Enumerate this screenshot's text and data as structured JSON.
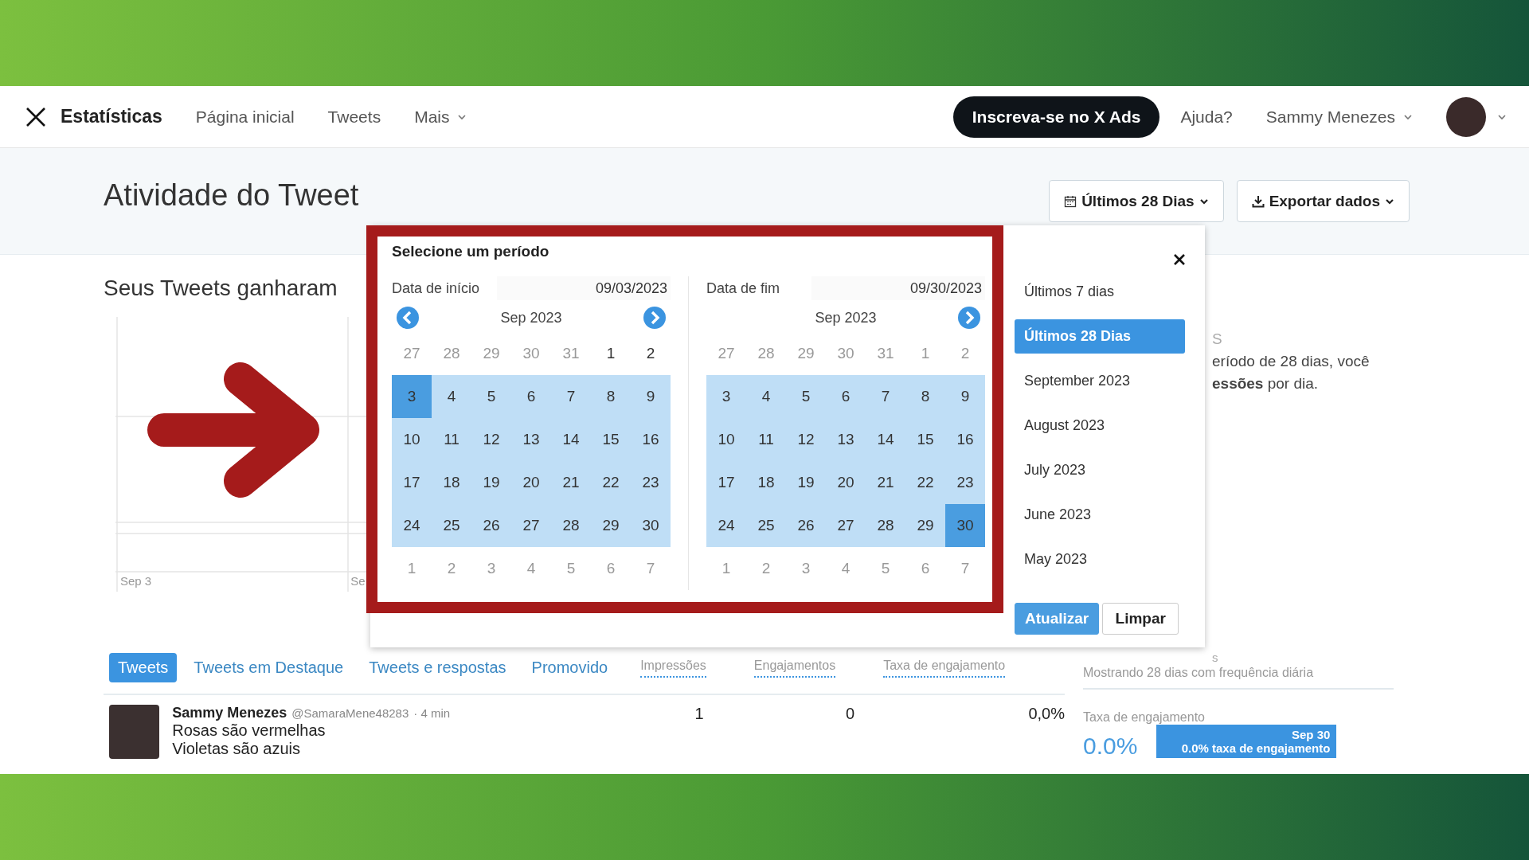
{
  "nav": {
    "brand": "Estatísticas",
    "links": [
      {
        "label": "Página inicial",
        "dropdown": false
      },
      {
        "label": "Tweets",
        "dropdown": false
      },
      {
        "label": "Mais",
        "dropdown": true
      }
    ],
    "ads_button": "Inscreva-se no X Ads",
    "help": "Ajuda?",
    "user": "Sammy Menezes"
  },
  "header": {
    "title": "Atividade do Tweet",
    "range_button": "Últimos 28 Dias",
    "export_button": "Exportar dados"
  },
  "summary": {
    "heading": "Seus Tweets ganharam",
    "side_heading": "S",
    "side_lines": [
      "eríodo de 28 dias, você",
      "**essões** por dia."
    ]
  },
  "chart": {
    "x_labels": [
      "Sep 3",
      "Se"
    ]
  },
  "date_picker": {
    "title": "Selecione um período",
    "calendars": [
      {
        "label": "Data de início",
        "value": "09/03/2023",
        "month": "Sep 2023",
        "prev": true,
        "next": true,
        "weeks": [
          [
            {
              "n": "27",
              "kind": "muted"
            },
            {
              "n": "28",
              "kind": "muted"
            },
            {
              "n": "29",
              "kind": "muted"
            },
            {
              "n": "30",
              "kind": "muted"
            },
            {
              "n": "31",
              "kind": "muted"
            },
            {
              "n": "1",
              "kind": "plain"
            },
            {
              "n": "2",
              "kind": "plain"
            }
          ],
          [
            {
              "n": "3",
              "kind": "endpoint"
            },
            {
              "n": "4",
              "kind": "range"
            },
            {
              "n": "5",
              "kind": "range"
            },
            {
              "n": "6",
              "kind": "range"
            },
            {
              "n": "7",
              "kind": "range"
            },
            {
              "n": "8",
              "kind": "range"
            },
            {
              "n": "9",
              "kind": "range"
            }
          ],
          [
            {
              "n": "10",
              "kind": "range"
            },
            {
              "n": "11",
              "kind": "range"
            },
            {
              "n": "12",
              "kind": "range"
            },
            {
              "n": "13",
              "kind": "range"
            },
            {
              "n": "14",
              "kind": "range"
            },
            {
              "n": "15",
              "kind": "range"
            },
            {
              "n": "16",
              "kind": "range"
            }
          ],
          [
            {
              "n": "17",
              "kind": "range"
            },
            {
              "n": "18",
              "kind": "range"
            },
            {
              "n": "19",
              "kind": "range"
            },
            {
              "n": "20",
              "kind": "range"
            },
            {
              "n": "21",
              "kind": "range"
            },
            {
              "n": "22",
              "kind": "range"
            },
            {
              "n": "23",
              "kind": "range"
            }
          ],
          [
            {
              "n": "24",
              "kind": "range"
            },
            {
              "n": "25",
              "kind": "range"
            },
            {
              "n": "26",
              "kind": "range"
            },
            {
              "n": "27",
              "kind": "range"
            },
            {
              "n": "28",
              "kind": "range"
            },
            {
              "n": "29",
              "kind": "range"
            },
            {
              "n": "30",
              "kind": "range"
            }
          ],
          [
            {
              "n": "1",
              "kind": "muted"
            },
            {
              "n": "2",
              "kind": "muted"
            },
            {
              "n": "3",
              "kind": "muted"
            },
            {
              "n": "4",
              "kind": "muted"
            },
            {
              "n": "5",
              "kind": "muted"
            },
            {
              "n": "6",
              "kind": "muted"
            },
            {
              "n": "7",
              "kind": "muted"
            }
          ]
        ]
      },
      {
        "label": "Data de fim",
        "value": "09/30/2023",
        "month": "Sep 2023",
        "prev": false,
        "next": true,
        "weeks": [
          [
            {
              "n": "27",
              "kind": "muted"
            },
            {
              "n": "28",
              "kind": "muted"
            },
            {
              "n": "29",
              "kind": "muted"
            },
            {
              "n": "30",
              "kind": "muted"
            },
            {
              "n": "31",
              "kind": "muted"
            },
            {
              "n": "1",
              "kind": "muted"
            },
            {
              "n": "2",
              "kind": "muted"
            }
          ],
          [
            {
              "n": "3",
              "kind": "range"
            },
            {
              "n": "4",
              "kind": "range"
            },
            {
              "n": "5",
              "kind": "range"
            },
            {
              "n": "6",
              "kind": "range"
            },
            {
              "n": "7",
              "kind": "range"
            },
            {
              "n": "8",
              "kind": "range"
            },
            {
              "n": "9",
              "kind": "range"
            }
          ],
          [
            {
              "n": "10",
              "kind": "range"
            },
            {
              "n": "11",
              "kind": "range"
            },
            {
              "n": "12",
              "kind": "range"
            },
            {
              "n": "13",
              "kind": "range"
            },
            {
              "n": "14",
              "kind": "range"
            },
            {
              "n": "15",
              "kind": "range"
            },
            {
              "n": "16",
              "kind": "range"
            }
          ],
          [
            {
              "n": "17",
              "kind": "range"
            },
            {
              "n": "18",
              "kind": "range"
            },
            {
              "n": "19",
              "kind": "range"
            },
            {
              "n": "20",
              "kind": "range"
            },
            {
              "n": "21",
              "kind": "range"
            },
            {
              "n": "22",
              "kind": "range"
            },
            {
              "n": "23",
              "kind": "range"
            }
          ],
          [
            {
              "n": "24",
              "kind": "range"
            },
            {
              "n": "25",
              "kind": "range"
            },
            {
              "n": "26",
              "kind": "range"
            },
            {
              "n": "27",
              "kind": "range"
            },
            {
              "n": "28",
              "kind": "range"
            },
            {
              "n": "29",
              "kind": "range"
            },
            {
              "n": "30",
              "kind": "endpoint"
            }
          ],
          [
            {
              "n": "1",
              "kind": "muted"
            },
            {
              "n": "2",
              "kind": "muted"
            },
            {
              "n": "3",
              "kind": "muted"
            },
            {
              "n": "4",
              "kind": "muted"
            },
            {
              "n": "5",
              "kind": "muted"
            },
            {
              "n": "6",
              "kind": "muted"
            },
            {
              "n": "7",
              "kind": "muted"
            }
          ]
        ]
      }
    ],
    "presets": [
      {
        "label": "Últimos 7 dias",
        "selected": false
      },
      {
        "label": "Últimos 28 Dias",
        "selected": true
      },
      {
        "label": "September 2023",
        "selected": false
      },
      {
        "label": "August 2023",
        "selected": false
      },
      {
        "label": "July 2023",
        "selected": false
      },
      {
        "label": "June 2023",
        "selected": false
      },
      {
        "label": "May 2023",
        "selected": false
      }
    ],
    "buttons": [
      {
        "label": "Atualizar",
        "kind": "primary"
      },
      {
        "label": "Limpar",
        "kind": "secondary"
      }
    ]
  },
  "tabs": [
    {
      "label": "Tweets",
      "selected": true
    },
    {
      "label": "Tweets em Destaque",
      "selected": false
    },
    {
      "label": "Tweets e respostas",
      "selected": false
    },
    {
      "label": "Promovido",
      "selected": false
    }
  ],
  "columns": [
    "Impressões",
    "Engajamentos",
    "Taxa de engajamento"
  ],
  "tweets": [
    {
      "name": "Sammy Menezes",
      "handle": "@SamaraMene48283",
      "time": "· 4 min",
      "lines": [
        "Rosas são vermelhas",
        "Violetas são azuis"
      ],
      "impressions": "1",
      "engagements": "0",
      "rate": "0,0%"
    }
  ],
  "side_panel": {
    "fragment": "s",
    "caption": "Mostrando 28 dias com frequência diária",
    "metric_label": "Taxa de engajamento",
    "metric_value": "0.0%",
    "tooltip": {
      "date": "Sep 30",
      "text": "0.0% taxa de engajamento"
    }
  }
}
